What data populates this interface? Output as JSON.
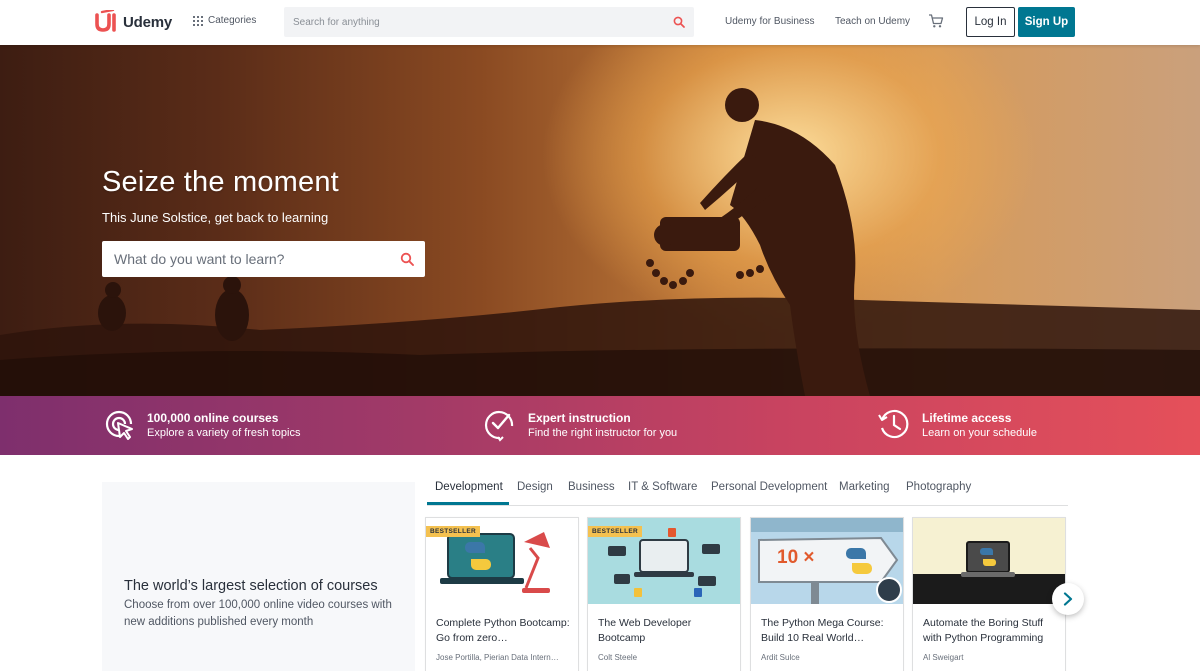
{
  "header": {
    "logo_text": "Udemy",
    "categories_label": "Categories",
    "search_placeholder": "Search for anything",
    "business_link": "Udemy for Business",
    "teach_link": "Teach on Udemy",
    "login_label": "Log In",
    "signup_label": "Sign Up"
  },
  "hero": {
    "title": "Seize the moment",
    "subtitle": "This June Solstice, get back to learning",
    "search_placeholder": "What do you want to learn?"
  },
  "features": [
    {
      "icon": "target-cursor-icon",
      "title": "100,000 online courses",
      "desc": "Explore a variety of fresh topics"
    },
    {
      "icon": "checkmark-badge-icon",
      "title": "Expert instruction",
      "desc": "Find the right instructor for you"
    },
    {
      "icon": "history-clock-icon",
      "title": "Lifetime access",
      "desc": "Learn on your schedule"
    }
  ],
  "promo": {
    "title": "The world’s largest selection of courses",
    "desc": "Choose from over 100,000 online video courses with new additions published every month"
  },
  "tabs": [
    "Development",
    "Design",
    "Business",
    "IT & Software",
    "Personal Development",
    "Marketing",
    "Photography"
  ],
  "active_tab": "Development",
  "courses": [
    {
      "badge": "BESTSELLER",
      "title": "Complete Python Bootcamp: Go from zero…",
      "author": "Jose Portilla, Pierian Data Intern…"
    },
    {
      "badge": "BESTSELLER",
      "title": "The Web Developer Bootcamp",
      "author": "Colt Steele"
    },
    {
      "badge": "",
      "thumb_text": "10 ×",
      "title": "The Python Mega Course: Build 10 Real World…",
      "author": "Ardit Sulce"
    },
    {
      "badge": "",
      "title": "Automate the Boring Stuff with Python Programming",
      "author": "Al Sweigart"
    }
  ],
  "colors": {
    "brand_red": "#ec5252",
    "teal": "#007791",
    "bestseller": "#f4c150",
    "strip_start": "#7e2f6d",
    "strip_end": "#e5505a"
  }
}
